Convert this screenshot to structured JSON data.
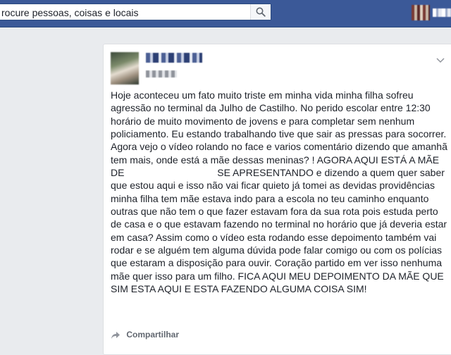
{
  "header": {
    "search": {
      "value": "rocure pessoas, coisas e locais",
      "icon": "search-icon"
    }
  },
  "post": {
    "author": {
      "name": "",
      "avatar": "avatar"
    },
    "body": {
      "part1": "Hoje aconteceu um fato muito triste em minha vida minha filha sofreu agressão no terminal da Julho de Castilho. No perido escolar entre 12:30 horário de muito movimento de jovens e para completar sem nenhum policiamento. Eu estando trabalhando tive que sair as pressas para socorrer. Agora vejo o vídeo rolando no face e varios comentário dizendo que amanhã tem mais, onde está a mãe dessas meninas? ! AGORA AQUI ESTÁ A MÃE DE",
      "part2": "SE APRESENTANDO e dizendo a quem quer saber que estou aqui e isso não vai ficar quieto já tomei as devidas providências minha filha tem mãe estava indo para a escola no teu caminho enquanto outras que não tem o que fazer estavam fora da sua rota pois estuda perto de casa e o que estavam fazendo no terminal no horário que já deveria estar em casa? Assim como o vídeo esta rodando esse depoimento também vai rodar e se alguém tem alguma dúvida pode falar comigo ou com os polícias que estaram a disposição para ouvir. Coração partido em ver isso nenhuma mãe quer isso para um filho. FICA AQUI MEU DEPOIMENTO DA MÃE QUE SIM ESTA AQUI E ESTA FAZENDO ALGUMA COISA SIM!"
    },
    "actions": {
      "share_label": "Compartilhar",
      "share_icon": "share-icon"
    },
    "menu_icon": "chevron-down-icon"
  },
  "colors": {
    "topbar": "#3b5998",
    "page_bg": "#e9ebee",
    "text": "#1d2129",
    "muted": "#616770"
  }
}
